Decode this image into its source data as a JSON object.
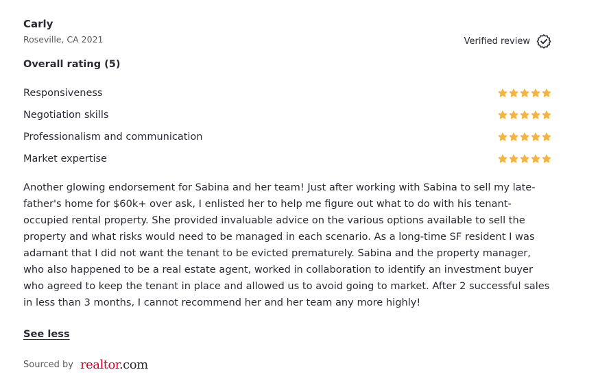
{
  "reviewer": {
    "name": "Carly",
    "meta": "Roseville, CA 2021"
  },
  "verified": {
    "label": "Verified review",
    "icon": "verified-badge-icon"
  },
  "overall_rating": {
    "label": "Overall rating (5)",
    "value": 5
  },
  "ratings": [
    {
      "label": "Responsiveness",
      "stars": 5
    },
    {
      "label": "Negotiation skills",
      "stars": 5
    },
    {
      "label": "Professionalism and communication",
      "stars": 5
    },
    {
      "label": "Market expertise",
      "stars": 5
    }
  ],
  "review_text": "Another glowing endorsement for Sabina and her team! Just after working with Sabina to sell my late-father's home for $60k+ over ask, I enlisted her to help me figure out what to do with his tenant-occupied rental property. She provided invaluable advice on the various options available to sell the property and what risks would need to be managed in each scenario. As a long-time SF resident I was adamant that I did not want the tenant to be evicted prematurely. Sabina and the property manager, who also happened to be a real estate agent, worked in collaboration to identify an investment buyer who agreed to keep the tenant in place and allowed us to avoid going to market. After 2 successful sales in less than 3 months, I cannot recommend her and her team any more highly!",
  "see_less": "See less",
  "source": {
    "label": "Sourced by",
    "logo_main": "realtor",
    "logo_dot": ".",
    "logo_com": "com"
  },
  "colors": {
    "star": "#f4b63f",
    "text": "#2a2a33",
    "brand": "#d6002f"
  }
}
